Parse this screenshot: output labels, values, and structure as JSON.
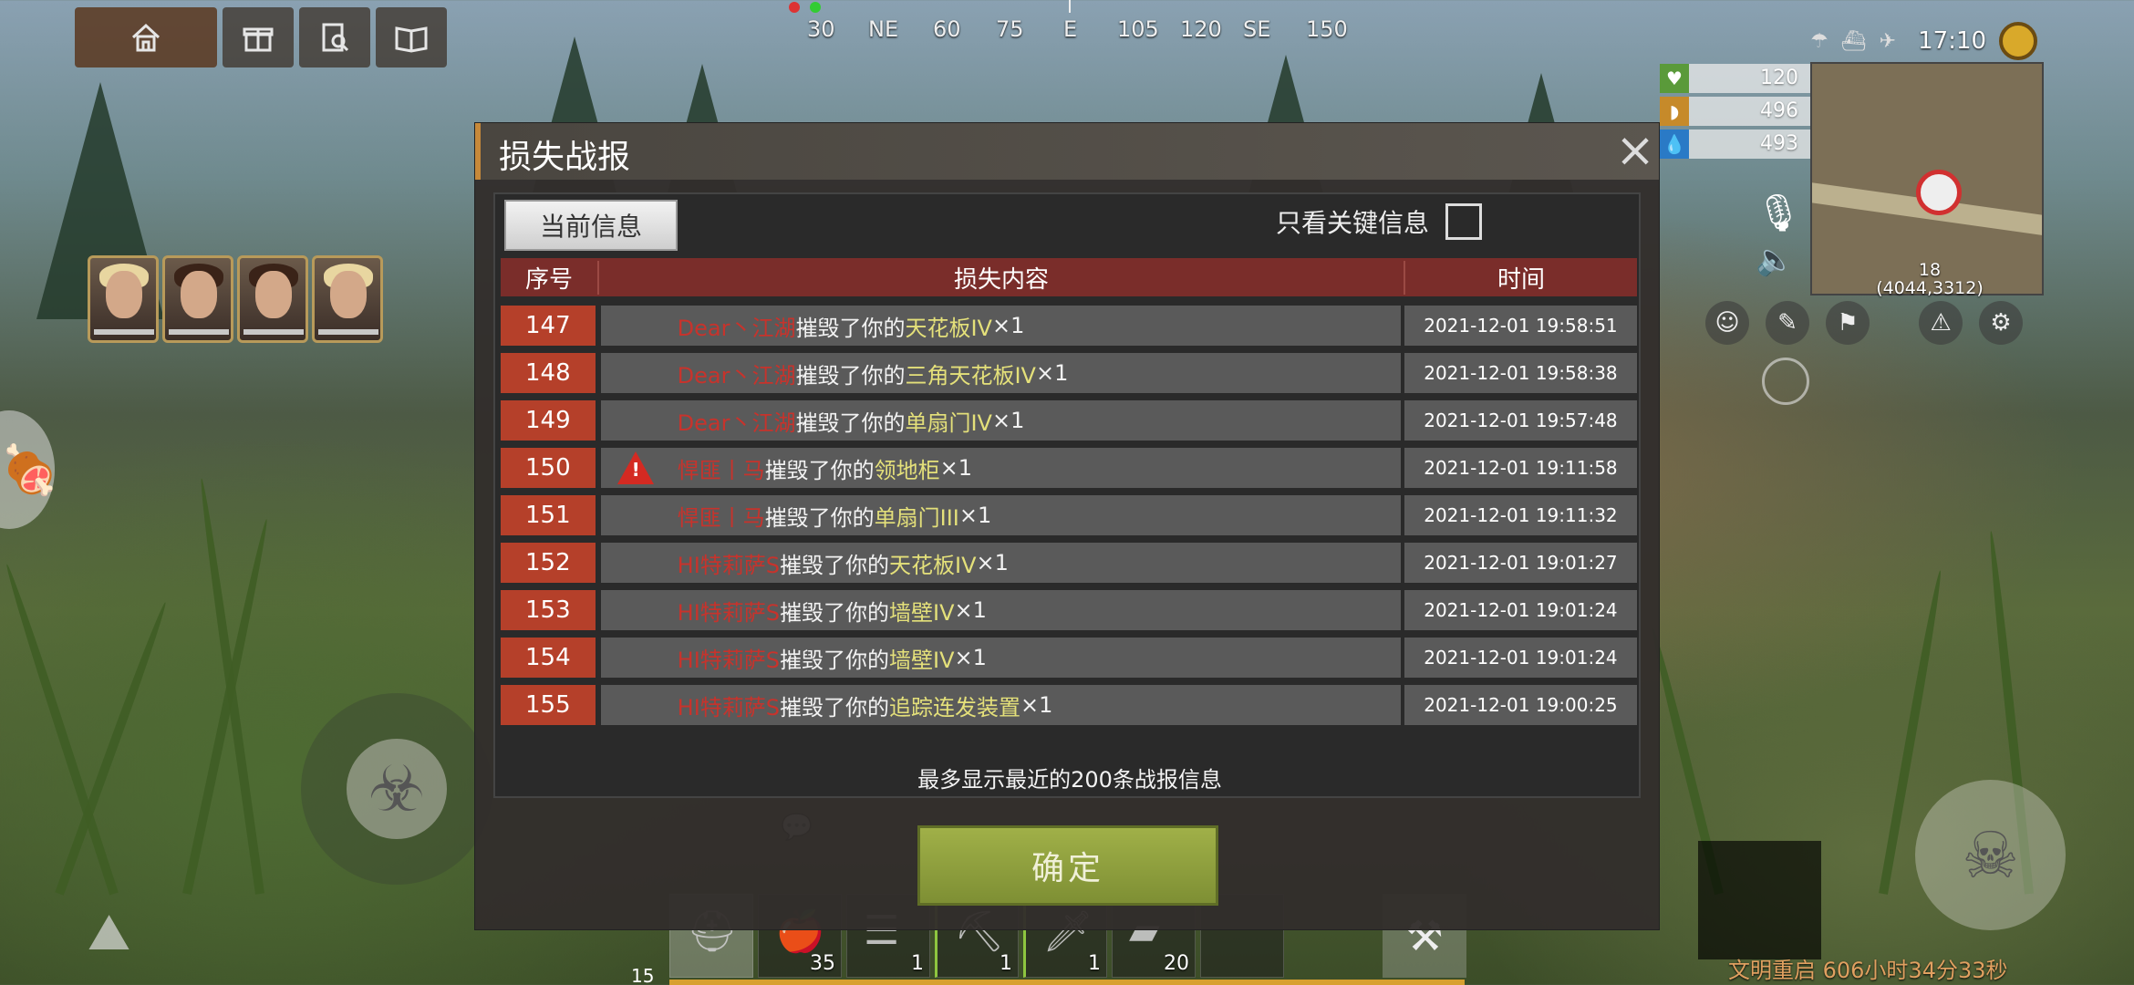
{
  "top_nav": {
    "home_icon": "home-icon",
    "gift_icon": "gift-icon",
    "search_icon": "search-doc-icon",
    "book_icon": "book-icon"
  },
  "compass": {
    "labels": [
      "30",
      "NE",
      "60",
      "75",
      "E",
      "105",
      "120",
      "SE",
      "150"
    ]
  },
  "clock": "17:10",
  "stats": {
    "health": "120",
    "food": "496",
    "water": "493"
  },
  "minimap": {
    "level": "18",
    "coords": "(4044,3312)"
  },
  "dialog": {
    "title": "损失战报",
    "tab_current": "当前信息",
    "key_only_label": "只看关键信息",
    "headers": {
      "seq": "序号",
      "content": "损失内容",
      "time": "时间"
    },
    "rows": [
      {
        "seq": "147",
        "player": "Dear丶江湖",
        "action": "摧毁了你的",
        "item": "天花板IV",
        "qty": "×1",
        "time": "2021-12-01 19:58:51",
        "warn": false
      },
      {
        "seq": "148",
        "player": "Dear丶江湖",
        "action": "摧毁了你的",
        "item": "三角天花板IV",
        "qty": "×1",
        "time": "2021-12-01 19:58:38",
        "warn": false
      },
      {
        "seq": "149",
        "player": "Dear丶江湖",
        "action": "摧毁了你的",
        "item": "单扇门IV",
        "qty": "×1",
        "time": "2021-12-01 19:57:48",
        "warn": false
      },
      {
        "seq": "150",
        "player": "悍匪丨马",
        "action": "摧毁了你的",
        "item": "领地柜",
        "qty": "×1",
        "time": "2021-12-01 19:11:58",
        "warn": true
      },
      {
        "seq": "151",
        "player": "悍匪丨马",
        "action": "摧毁了你的",
        "item": "单扇门III",
        "qty": "×1",
        "time": "2021-12-01 19:11:32",
        "warn": false
      },
      {
        "seq": "152",
        "player": "HI特莉萨S",
        "action": "摧毁了你的",
        "item": "天花板IV",
        "qty": "×1",
        "time": "2021-12-01 19:01:27",
        "warn": false
      },
      {
        "seq": "153",
        "player": "HI特莉萨S",
        "action": "摧毁了你的",
        "item": "墙壁IV",
        "qty": "×1",
        "time": "2021-12-01 19:01:24",
        "warn": false
      },
      {
        "seq": "154",
        "player": "HI特莉萨S",
        "action": "摧毁了你的",
        "item": "墙壁IV",
        "qty": "×1",
        "time": "2021-12-01 19:01:24",
        "warn": false
      },
      {
        "seq": "155",
        "player": "HI特莉萨S",
        "action": "摧毁了你的",
        "item": "追踪连发装置",
        "qty": "×1",
        "time": "2021-12-01 19:00:25",
        "warn": false
      }
    ],
    "footer_note": "最多显示最近的200条战报信息",
    "confirm_label": "确定"
  },
  "hotbar": {
    "total": "15",
    "slots": [
      {
        "icon": "backpack-icon",
        "count": ""
      },
      {
        "icon": "food-potion-icon",
        "count": "35"
      },
      {
        "icon": "ladder-icon",
        "count": "1"
      },
      {
        "icon": "pickaxe-icon",
        "count": "1"
      },
      {
        "icon": "knife-icon",
        "count": "1"
      },
      {
        "icon": "metal-icon",
        "count": "20"
      },
      {
        "icon": "empty-slot",
        "count": ""
      }
    ]
  },
  "rebirth_timer": "文明重启 606小时34分33秒",
  "colors": {
    "player_name": "#c7332c",
    "item_name": "#e4e07a",
    "seq_cell": "#b5402a",
    "confirm_button": "#8e9f3c",
    "header_row": "#7a2d2a"
  }
}
